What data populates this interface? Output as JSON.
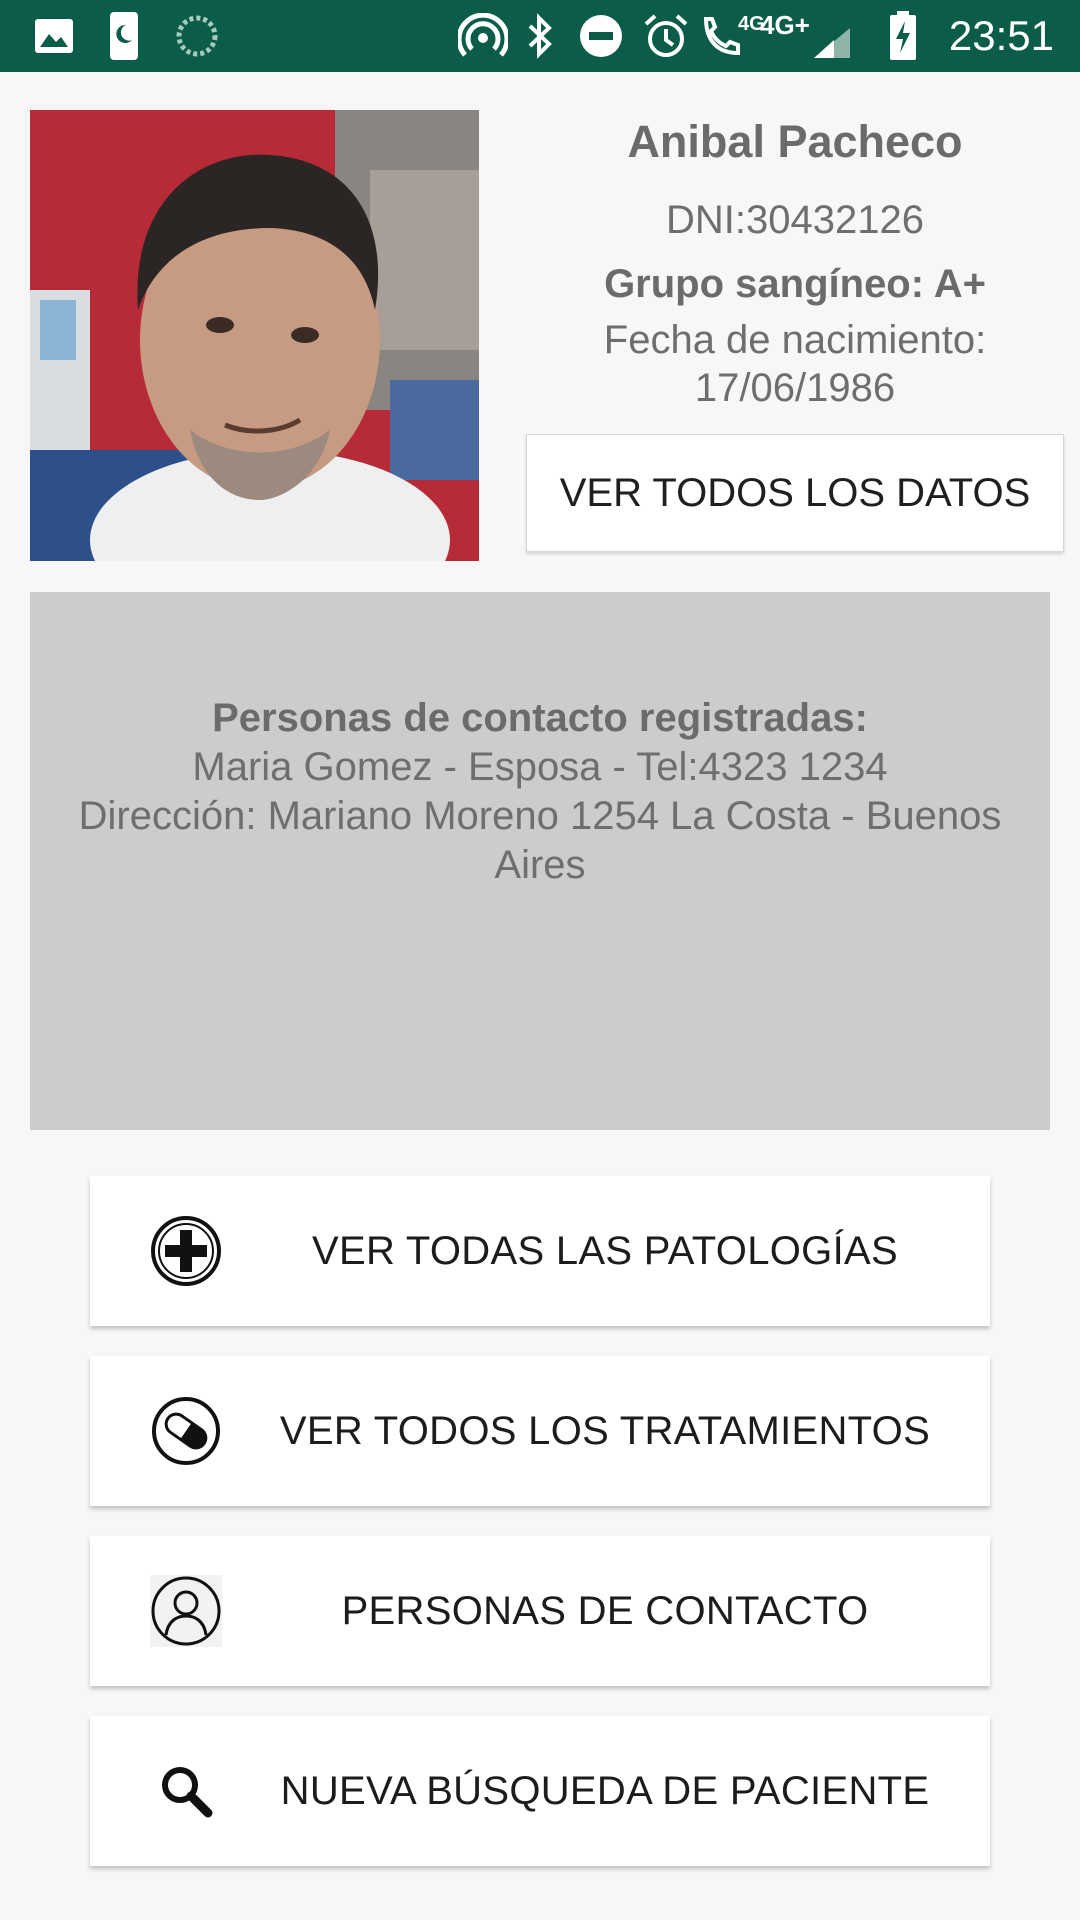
{
  "status_bar": {
    "time": "23:51",
    "network_small": "4G",
    "network": "4G+",
    "icons": [
      "image-icon",
      "phone-moon-icon",
      "loading-icon",
      "hotspot-icon",
      "bluetooth-icon",
      "do-not-disturb-icon",
      "alarm-icon",
      "wifi-call-icon",
      "signal-icon",
      "battery-charging-icon"
    ]
  },
  "patient": {
    "name": "Anibal Pacheco",
    "dni": "DNI:30432126",
    "blood_group": "Grupo sangíneo: A+",
    "birth_label": "Fecha de nacimiento:",
    "birth_date": "17/06/1986",
    "view_all_button": "VER TODOS LOS DATOS"
  },
  "contacts": {
    "title": "Personas de contacto registradas:",
    "line1": "Maria Gomez - Esposa - Tel:4323 1234",
    "line2": "Dirección: Mariano Moreno 1254 La Costa - Buenos Aires"
  },
  "actions": [
    {
      "label": "VER TODAS LAS PATOLOGÍAS",
      "icon": "plus-circle-icon"
    },
    {
      "label": "VER TODOS LOS TRATAMIENTOS",
      "icon": "pill-icon"
    },
    {
      "label": "PERSONAS DE CONTACTO",
      "icon": "person-icon"
    },
    {
      "label": "NUEVA BÚSQUEDA DE PACIENTE",
      "icon": "search-icon"
    }
  ],
  "colors": {
    "status_bar": "#0b5c48",
    "background": "#f7f7f7",
    "contact_box": "#cccccc",
    "text_gray": "#6e6e6e"
  }
}
